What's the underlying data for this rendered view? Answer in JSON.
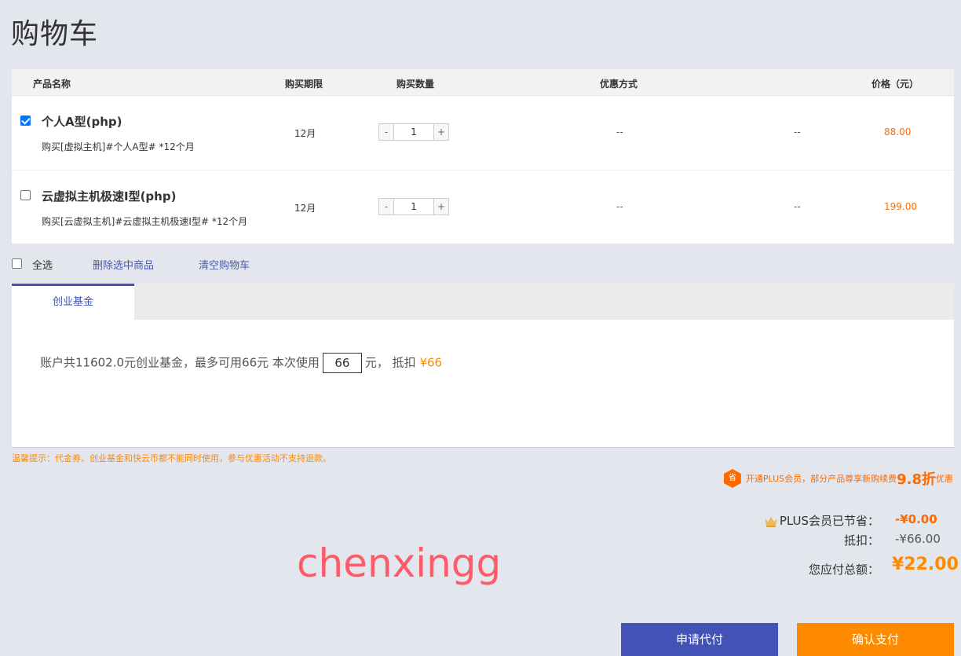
{
  "page": {
    "title": "购物车"
  },
  "table": {
    "headers": {
      "name": "产品名称",
      "period": "购买期限",
      "quantity": "购买数量",
      "discount": "优惠方式",
      "price": "价格（元）"
    },
    "rows": [
      {
        "checked": true,
        "name": "个人A型(php)",
        "desc": "购买[虚拟主机]#个人A型# *12个月",
        "period": "12月",
        "minus": "-",
        "qty": "1",
        "plus": "+",
        "discount": "--",
        "discount2": "--",
        "price": "88.00"
      },
      {
        "checked": false,
        "name": "云虚拟主机极速I型(php)",
        "desc": "购买[云虚拟主机]#云虚拟主机极速I型# *12个月",
        "period": "12月",
        "minus": "-",
        "qty": "1",
        "plus": "+",
        "discount": "--",
        "discount2": "--",
        "price": "199.00"
      }
    ]
  },
  "bulk": {
    "select_all": "全选",
    "delete_selected": "删除选中商品",
    "clear_cart": "清空购物车"
  },
  "fund": {
    "tab": "创业基金",
    "text_before": "账户共11602.0元创业基金，最多可用66元   本次使用",
    "input_value": "66",
    "text_after": "元，  抵扣",
    "deduct_amount": "¥66"
  },
  "tip": "温馨提示：代金券、创业基金和快云币都不能同时使用，参与优惠活动不支持退款。",
  "plus_promo": {
    "badge": "省",
    "text1": "开通PLUS会员，部分产品尊享新购续费",
    "big": "9.8折",
    "text2": "优惠"
  },
  "summary": {
    "plus_saved_label": "PLUS会员已节省：",
    "plus_saved_value": "-¥0.00",
    "deduct_label": "抵扣：",
    "deduct_value": "-¥66.00",
    "total_label": "您应付总额：",
    "total_value": "¥22.00"
  },
  "watermark": "chenxingg",
  "buttons": {
    "request_pay": "申请代付",
    "confirm_pay": "确认支付"
  },
  "colors": {
    "accent": "#3f51b5",
    "orange": "#ff8a00",
    "price": "#ff6a00"
  }
}
